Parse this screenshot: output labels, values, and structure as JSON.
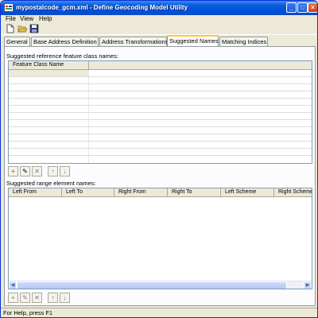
{
  "window": {
    "title": "mypostalcode_gcm.xml - Define Geocoding Model Utility"
  },
  "titlebar_buttons": {
    "minimize": "_",
    "maximize": "□",
    "close": "×"
  },
  "menu": {
    "file": "File",
    "view": "View",
    "help": "Help"
  },
  "toolbar": {
    "icons": [
      "new-document-icon",
      "open-folder-icon",
      "save-disk-icon"
    ]
  },
  "tabs": [
    {
      "label": "General"
    },
    {
      "label": "Base Address Definition"
    },
    {
      "label": "Address Transformations"
    },
    {
      "label": "Suggested Names",
      "active": true
    },
    {
      "label": "Matching Indices"
    }
  ],
  "feature_section": {
    "label": "Suggested reference feature class names:",
    "columns": [
      "Feature Class Name"
    ],
    "buttons": [
      {
        "name": "add",
        "glyph": "+",
        "enabled": true
      },
      {
        "name": "edit",
        "glyph": "✎",
        "enabled": true
      },
      {
        "name": "delete",
        "glyph": "✕",
        "enabled": false
      },
      {
        "name": "move-up",
        "glyph": "↑",
        "enabled": false
      },
      {
        "name": "move-down",
        "glyph": "↓",
        "enabled": false
      }
    ]
  },
  "range_section": {
    "label": "Suggested range element names:",
    "columns": [
      "Left From",
      "Left To",
      "Right From",
      "Right To",
      "Left Scheme",
      "Right Scheme"
    ],
    "buttons": [
      {
        "name": "add",
        "glyph": "+",
        "enabled": false
      },
      {
        "name": "edit",
        "glyph": "✎",
        "enabled": false
      },
      {
        "name": "delete",
        "glyph": "✕",
        "enabled": false
      },
      {
        "name": "move-up",
        "glyph": "↑",
        "enabled": false
      },
      {
        "name": "move-down",
        "glyph": "↓",
        "enabled": false
      }
    ]
  },
  "status": {
    "text": "For Help, press F1"
  },
  "colors": {
    "titlebar": "#0053e1",
    "face": "#ece9d8",
    "active_tab_accent": "#ffc83c",
    "add_icon": "#e8c000"
  }
}
